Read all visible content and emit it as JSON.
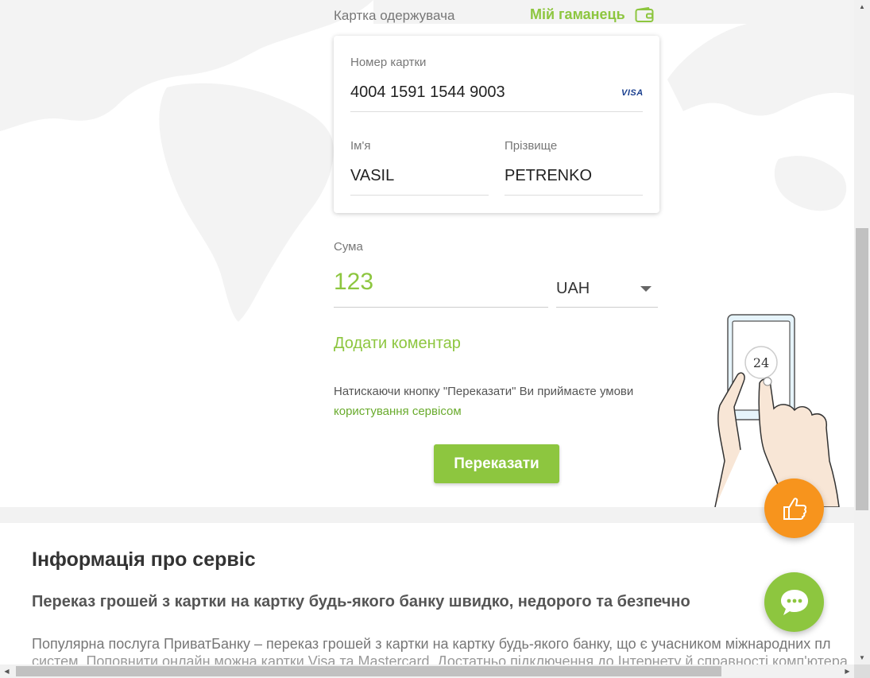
{
  "transfer": {
    "recipient_label": "Картка одержувача",
    "wallet_link": "Мій гаманець",
    "card": {
      "number_label": "Номер картки",
      "number_value": "4004 1591 1544 9003",
      "card_brand": "VISA",
      "first_name_label": "Ім'я",
      "first_name_value": "VASIL",
      "last_name_label": "Прізвище",
      "last_name_value": "PETRENKO"
    },
    "sum_label": "Сума",
    "sum_value": "123",
    "currency": "UAH",
    "add_comment": "Додати коментар",
    "terms_text": "Натискаючи кнопку \"Переказати\" Ви приймаєте умови ",
    "terms_link": "користування сервісом",
    "submit_label": "Переказати"
  },
  "illustration": {
    "badge": "24"
  },
  "info": {
    "title": "Інформація про сервіс",
    "subtitle": "Переказ грошей з картки на картку будь-якого банку швидко, недорого та безпечно",
    "paragraph": "Популярна послуга ПриватБанку – переказ грошей з картки на картку будь-якого банку, що є учасником міжнародних пл",
    "paragraph_cut": "систем. Поповнити онлайн можна картки Visa та Mastercard. Достатньо підключення до Інтернету й справності комп'ютера"
  },
  "colors": {
    "accent_green": "#8dc63f",
    "accent_orange": "#f7941d"
  },
  "icons": {
    "wallet": "wallet-icon",
    "like": "thumbs-up-icon",
    "chat": "chat-bubble-icon"
  }
}
